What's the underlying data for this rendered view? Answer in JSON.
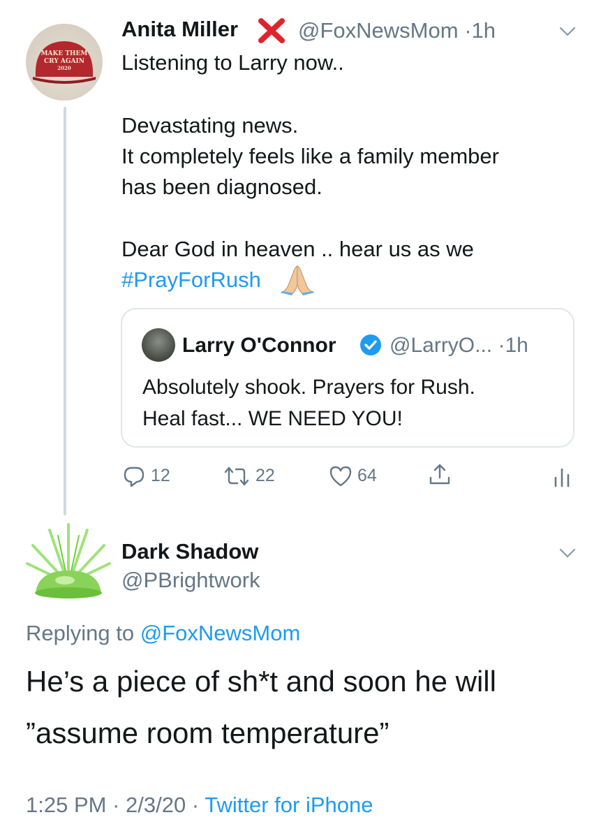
{
  "tweet1": {
    "author_name": "Anita Miller",
    "handle": "@FoxNewsMom",
    "time_sep": "·",
    "time": "1h",
    "avatar_text": {
      "line1": "MAKE THEM",
      "line2": "CRY AGAIN",
      "line3": "2020"
    },
    "lines": [
      "Listening to Larry now..",
      "Devastating news.",
      "It completely feels like a family member",
      "has been diagnosed.",
      "Dear God in heaven .. hear us as we"
    ],
    "hashtag": "#PrayForRush",
    "icons": {
      "x_emoji": "cross-mark-icon",
      "pray_emoji": "folded-hands-icon",
      "menu": "chevron-down-icon"
    },
    "quote": {
      "author_name": "Larry O'Connor",
      "handle": "@LarryO...",
      "time_sep": "·",
      "time": "1h",
      "lines": [
        "Absolutely shook. Prayers for Rush.",
        "Heal fast... WE NEED YOU!"
      ]
    },
    "actions": {
      "replies": "12",
      "retweets": "22",
      "likes": "64"
    }
  },
  "tweet2": {
    "author_name": "Dark Shadow",
    "handle": "@PBrightwork",
    "replying_prefix": "Replying to",
    "replying_to": "@FoxNewsMom",
    "lines": [
      "He’s a piece of sh*t and soon he will",
      "”assume room temperature”"
    ],
    "time": "1:25 PM",
    "sep1": "·",
    "date": "2/3/20",
    "sep2": "·",
    "source": "Twitter for iPhone"
  },
  "colors": {
    "link": "#1d9bf0",
    "muted": "#657786",
    "text": "#14171a",
    "thread_line": "#cfd9de"
  }
}
